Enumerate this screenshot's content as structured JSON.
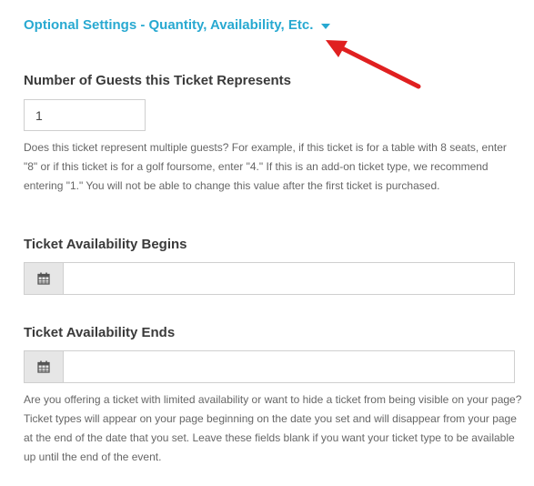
{
  "optional_settings": {
    "toggle_label": "Optional Settings - Quantity, Availability, Etc."
  },
  "guests": {
    "label": "Number of Guests this Ticket Represents",
    "value": "1",
    "help": "Does this ticket represent multiple guests? For example, if this ticket is for a table with 8 seats, enter \"8\" or if this ticket is for a golf foursome, enter \"4.\" If this is an add-on ticket type, we recommend entering \"1.\" You will not be able to change this value after the first ticket is purchased."
  },
  "availability_begins": {
    "label": "Ticket Availability Begins",
    "value": ""
  },
  "availability_ends": {
    "label": "Ticket Availability Ends",
    "value": ""
  },
  "availability_help": "Are you offering a ticket with limited availability or want to hide a ticket from being visible on your page? Ticket types will appear on your page beginning on the date you set and will disappear from your page at the end of the date that you set. Leave these fields blank if you want your ticket type to be available up until the end of the event.",
  "colors": {
    "accent": "#28a9d1",
    "annotation_arrow": "#e02020"
  },
  "icons": {
    "caret": "caret-down-icon",
    "date_picker": "calendar-icon",
    "annotation": "red-arrow"
  }
}
